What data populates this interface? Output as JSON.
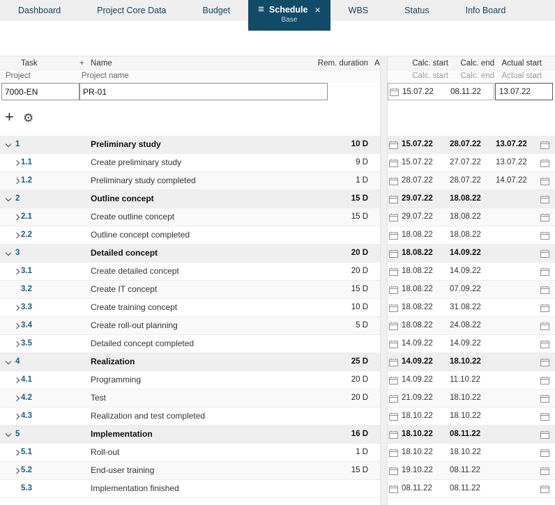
{
  "tabs": [
    {
      "label": "Dashboard",
      "active": false
    },
    {
      "label": "Project Core Data",
      "active": false
    },
    {
      "label": "Budget",
      "active": false
    },
    {
      "label": "Schedule",
      "active": true,
      "sublabel": "Base"
    },
    {
      "label": "WBS",
      "active": false
    },
    {
      "label": "Status",
      "active": false
    },
    {
      "label": "Info Board",
      "active": false
    }
  ],
  "columns": {
    "task": "Task",
    "add": "+",
    "name": "Name",
    "rem_duration": "Rem. duration",
    "a": "A",
    "calc_start": "Calc. start",
    "calc_end": "Calc. end",
    "actual_start": "Actual start"
  },
  "subheader": {
    "project": "Project",
    "project_name": "Project name",
    "calc_start": "Calc. start",
    "calc_end": "Calc. end",
    "actual_start": "Actual start"
  },
  "project": {
    "id": "7000-EN",
    "name": "PR-01",
    "calc_start": "15.07.22",
    "calc_end": "08.11.22",
    "actual_start": "13.07.22"
  },
  "toolbar": {
    "add": "+",
    "gear": "⚙"
  },
  "colors": {
    "active_tab_bg": "#114b68",
    "task_id_text": "#175e83",
    "tab_bar_bg": "#efefef"
  },
  "tasks": [
    {
      "id": "1",
      "name": "Preliminary study",
      "duration": "10 D",
      "calc_start": "15.07.22",
      "calc_end": "28.07.22",
      "actual_start": "13.07.22",
      "group": true,
      "chevron": "down"
    },
    {
      "id": "1.1",
      "name": "Create preliminary study",
      "duration": "9 D",
      "calc_start": "15.07.22",
      "calc_end": "27.07.22",
      "actual_start": "13.07.22",
      "group": false,
      "chevron": "right"
    },
    {
      "id": "1.2",
      "name": "Preliminary study completed",
      "duration": "1 D",
      "calc_start": "28.07.22",
      "calc_end": "28.07.22",
      "actual_start": "14.07.22",
      "group": false,
      "chevron": "right"
    },
    {
      "id": "2",
      "name": "Outline concept",
      "duration": "15 D",
      "calc_start": "29.07.22",
      "calc_end": "18.08.22",
      "actual_start": "",
      "group": true,
      "chevron": "down"
    },
    {
      "id": "2.1",
      "name": "Create outline concept",
      "duration": "15 D",
      "calc_start": "29.07.22",
      "calc_end": "18.08.22",
      "actual_start": "",
      "group": false,
      "chevron": "right"
    },
    {
      "id": "2.2",
      "name": "Outline concept completed",
      "duration": "",
      "calc_start": "18.08.22",
      "calc_end": "18.08.22",
      "actual_start": "",
      "group": false,
      "chevron": "right"
    },
    {
      "id": "3",
      "name": "Detailed concept",
      "duration": "20 D",
      "calc_start": "18.08.22",
      "calc_end": "14.09.22",
      "actual_start": "",
      "group": true,
      "chevron": "down"
    },
    {
      "id": "3.1",
      "name": "Create detailed concept",
      "duration": "20 D",
      "calc_start": "18.08.22",
      "calc_end": "14.09.22",
      "actual_start": "",
      "group": false,
      "chevron": "right"
    },
    {
      "id": "3.2",
      "name": "Create IT concept",
      "duration": "15 D",
      "calc_start": "18.08.22",
      "calc_end": "07.09.22",
      "actual_start": "",
      "group": false,
      "chevron": "none"
    },
    {
      "id": "3.3",
      "name": "Create training concept",
      "duration": "10 D",
      "calc_start": "18.08.22",
      "calc_end": "31.08.22",
      "actual_start": "",
      "group": false,
      "chevron": "right"
    },
    {
      "id": "3.4",
      "name": "Create roll-out planning",
      "duration": "5 D",
      "calc_start": "18.08.22",
      "calc_end": "24.08.22",
      "actual_start": "",
      "group": false,
      "chevron": "right"
    },
    {
      "id": "3.5",
      "name": "Detailed concept completed",
      "duration": "",
      "calc_start": "14.09.22",
      "calc_end": "14.09.22",
      "actual_start": "",
      "group": false,
      "chevron": "right"
    },
    {
      "id": "4",
      "name": "Realization",
      "duration": "25 D",
      "calc_start": "14.09.22",
      "calc_end": "18.10.22",
      "actual_start": "",
      "group": true,
      "chevron": "down"
    },
    {
      "id": "4.1",
      "name": "Programming",
      "duration": "20 D",
      "calc_start": "14.09.22",
      "calc_end": "11.10.22",
      "actual_start": "",
      "group": false,
      "chevron": "right"
    },
    {
      "id": "4.2",
      "name": "Test",
      "duration": "20 D",
      "calc_start": "21.09.22",
      "calc_end": "18.10.22",
      "actual_start": "",
      "group": false,
      "chevron": "right"
    },
    {
      "id": "4.3",
      "name": "Realization and test completed",
      "duration": "",
      "calc_start": "18.10.22",
      "calc_end": "18.10.22",
      "actual_start": "",
      "group": false,
      "chevron": "right"
    },
    {
      "id": "5",
      "name": "Implementation",
      "duration": "16 D",
      "calc_start": "18.10.22",
      "calc_end": "08.11.22",
      "actual_start": "",
      "group": true,
      "chevron": "down"
    },
    {
      "id": "5.1",
      "name": "Roll-out",
      "duration": "1 D",
      "calc_start": "18.10.22",
      "calc_end": "18.10.22",
      "actual_start": "",
      "group": false,
      "chevron": "right"
    },
    {
      "id": "5.2",
      "name": "End-user training",
      "duration": "15 D",
      "calc_start": "19.10.22",
      "calc_end": "08.11.22",
      "actual_start": "",
      "group": false,
      "chevron": "right"
    },
    {
      "id": "5.3",
      "name": "Implementation finished",
      "duration": "",
      "calc_start": "08.11.22",
      "calc_end": "08.11.22",
      "actual_start": "",
      "group": false,
      "chevron": "none"
    }
  ]
}
